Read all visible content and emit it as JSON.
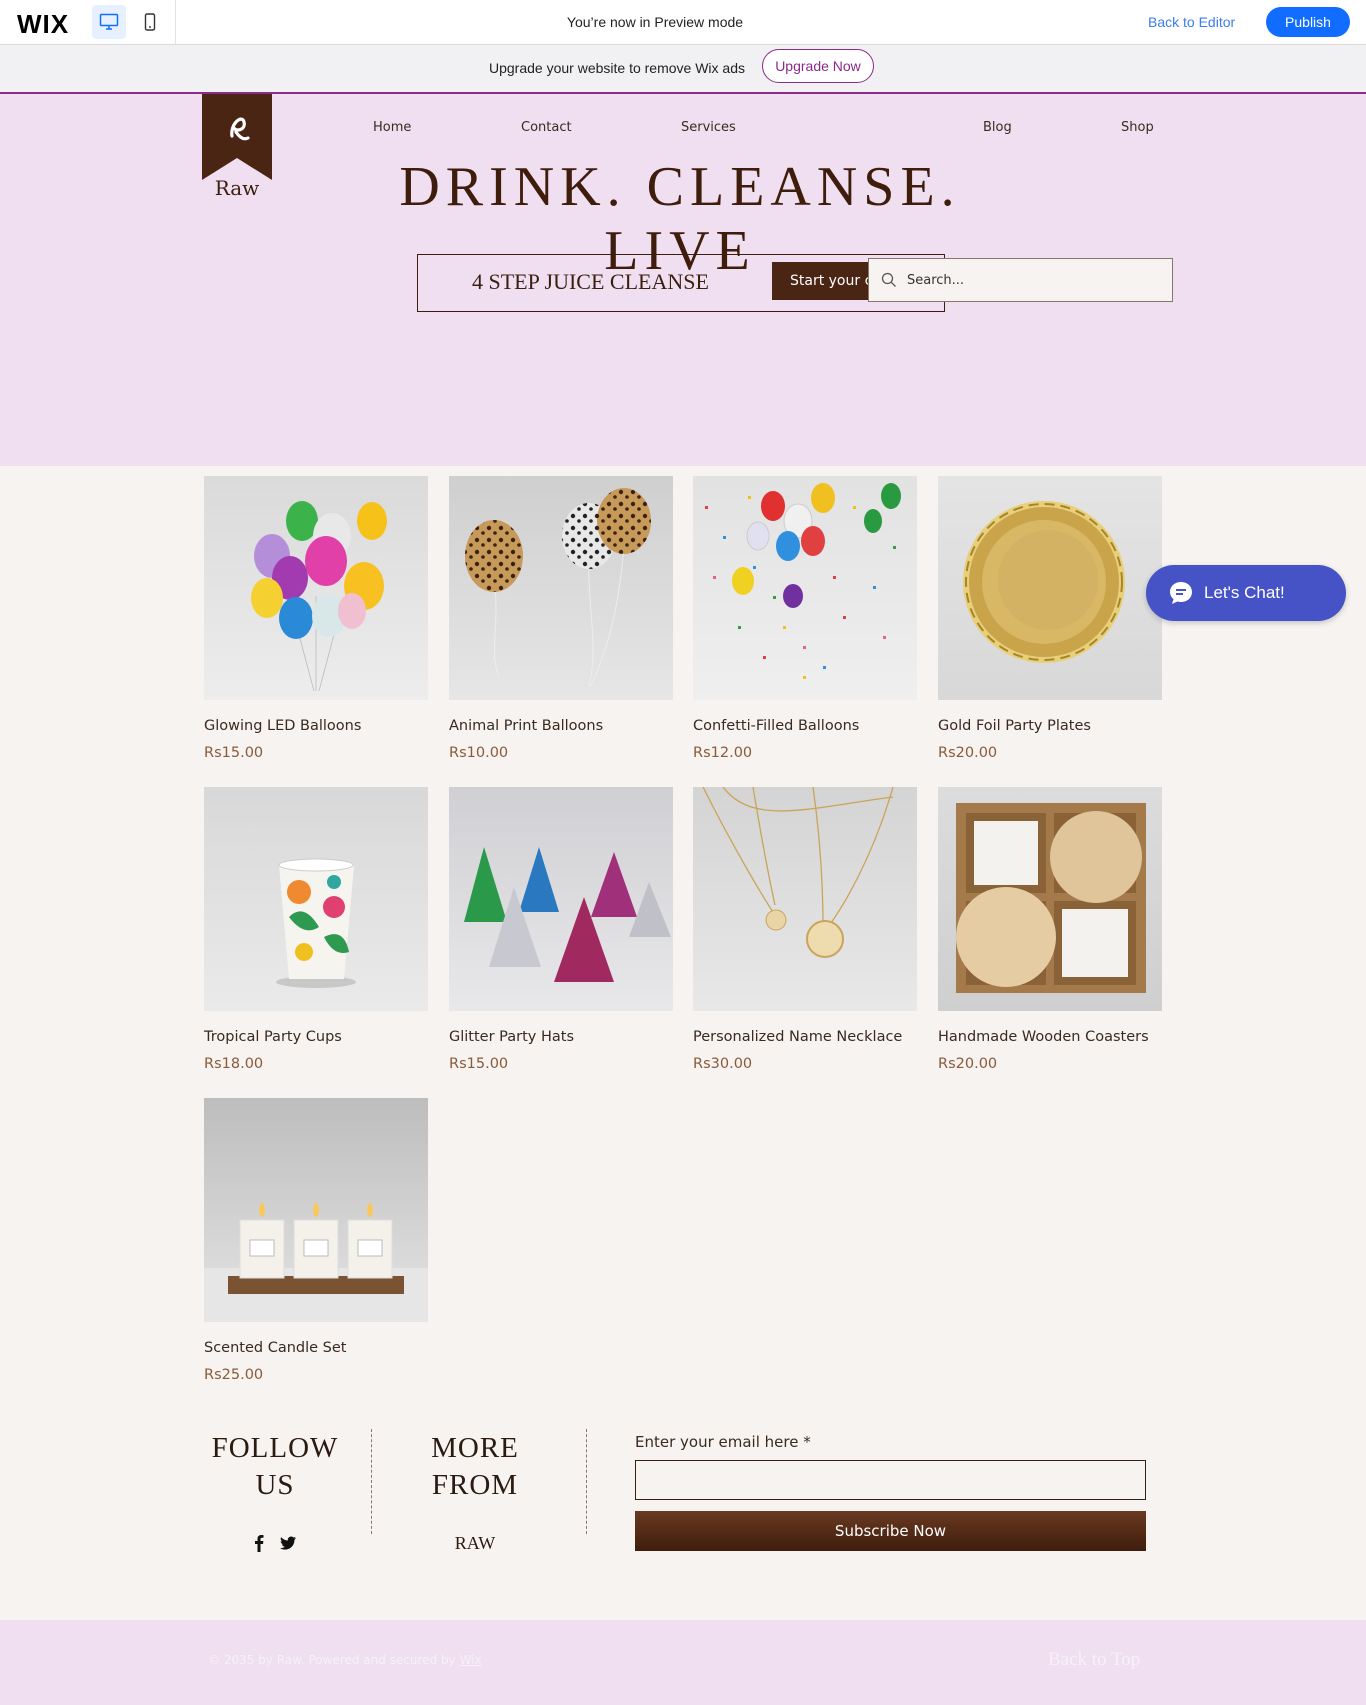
{
  "wix_bar": {
    "logo": "WIX",
    "preview_text": "You’re now in Preview mode",
    "back_to_editor": "Back to Editor",
    "publish": "Publish"
  },
  "ad_bar": {
    "text": "Upgrade your website to remove Wix ads",
    "button": "Upgrade Now"
  },
  "site": {
    "logo_text": "Raw",
    "nav": [
      "Home",
      "Contact",
      "Services",
      "Blog",
      "Shop"
    ],
    "headline": "DRINK. CLEANSE. LIVE",
    "cleanse_label": "4 STEP JUICE CLEANSE",
    "cleanse_button": "Start your cleanse",
    "search_placeholder": "Search..."
  },
  "products": [
    {
      "name": "Glowing LED Balloons",
      "price": "Rs15.00"
    },
    {
      "name": "Animal Print Balloons",
      "price": "Rs10.00"
    },
    {
      "name": "Confetti-Filled Balloons",
      "price": "Rs12.00"
    },
    {
      "name": "Gold Foil Party Plates",
      "price": "Rs20.00"
    },
    {
      "name": "Tropical Party Cups",
      "price": "Rs18.00"
    },
    {
      "name": "Glitter Party Hats",
      "price": "Rs15.00"
    },
    {
      "name": "Personalized Name Necklace",
      "price": "Rs30.00"
    },
    {
      "name": "Handmade Wooden Coasters",
      "price": "Rs20.00"
    },
    {
      "name": "Scented Candle Set",
      "price": "Rs25.00"
    }
  ],
  "chat": {
    "label": "Let's Chat!"
  },
  "footer": {
    "follow_line1": "FOLLOW",
    "follow_line2": "US",
    "more_line1": "MORE",
    "more_line2": "FROM",
    "more_link": "RAW",
    "email_label": "Enter your email here *",
    "subscribe": "Subscribe Now",
    "copyright_prefix": "© 2035 by Raw. Powered and secured by ",
    "copyright_link": "Wix",
    "back_to_top": "Back to Top"
  },
  "colors": {
    "hero_bg": "#efdff0",
    "brand_brown": "#3f1d0c",
    "page_bg": "#f6f3f0",
    "wix_blue": "#116dff",
    "chat_blue": "#4553c6",
    "ad_purple": "#8a2a8a"
  }
}
